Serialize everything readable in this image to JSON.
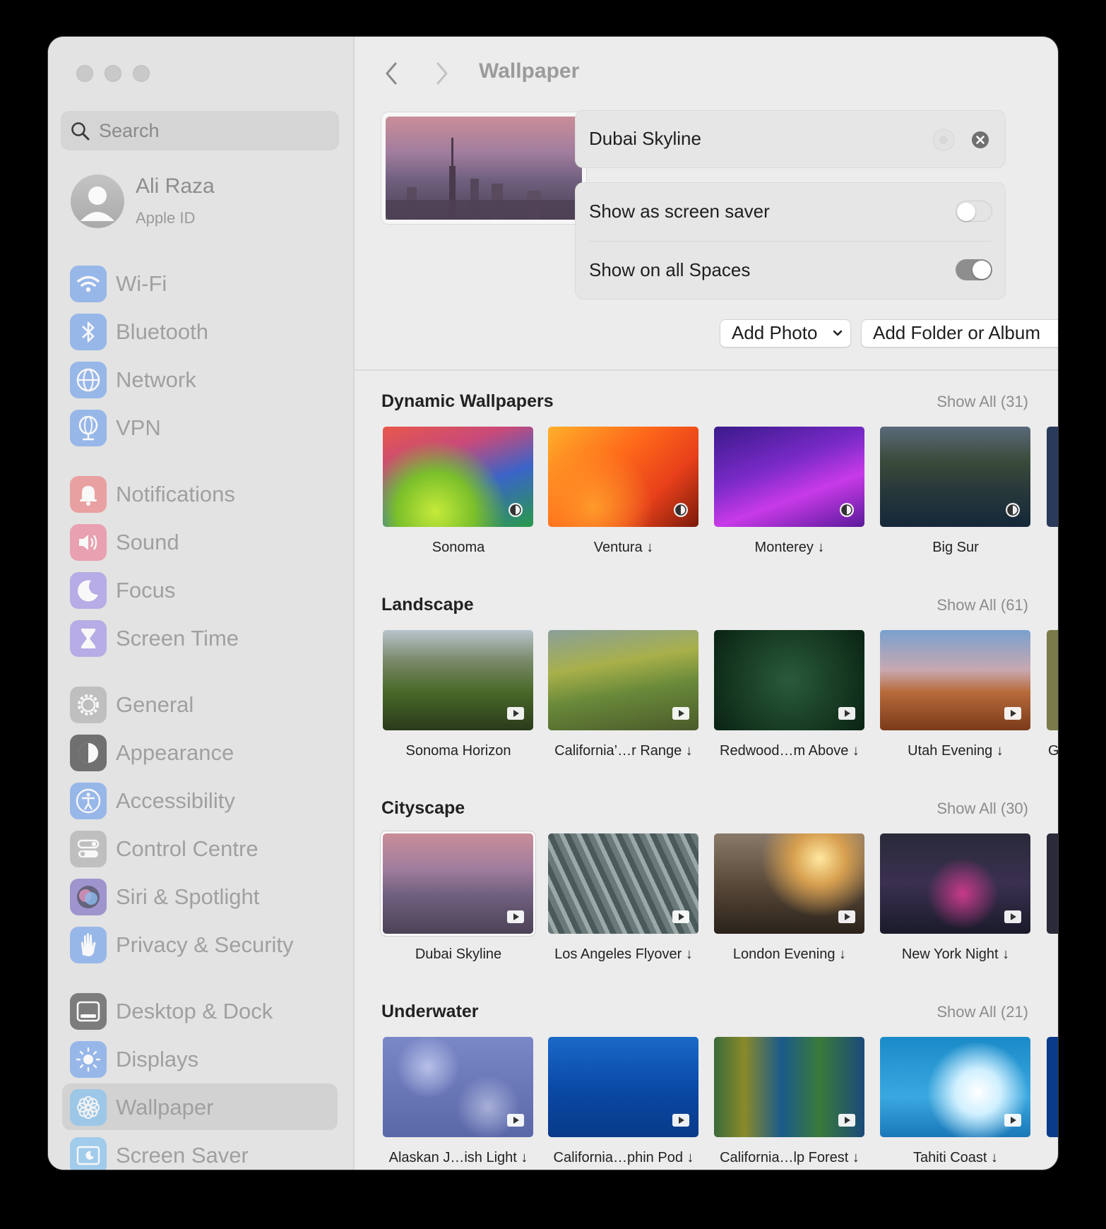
{
  "window": {
    "title": "Wallpaper"
  },
  "sidebar": {
    "search_placeholder": "Search",
    "profile": {
      "name": "Ali Raza",
      "subtitle": "Apple ID"
    },
    "items": [
      {
        "label": "Wi-Fi",
        "icon": "wifi-icon",
        "color": "#7fa9ec"
      },
      {
        "label": "Bluetooth",
        "icon": "bluetooth-icon",
        "color": "#7fa9ec"
      },
      {
        "label": "Network",
        "icon": "globe-icon",
        "color": "#7fa9ec"
      },
      {
        "label": "VPN",
        "icon": "vpn-globe-icon",
        "color": "#7fa9ec"
      },
      {
        "label": "Notifications",
        "icon": "bell-icon",
        "color": "#ec8a8a"
      },
      {
        "label": "Sound",
        "icon": "speaker-icon",
        "color": "#ec8aa0"
      },
      {
        "label": "Focus",
        "icon": "moon-icon",
        "color": "#a99ae6"
      },
      {
        "label": "Screen Time",
        "icon": "hourglass-icon",
        "color": "#a99ae6"
      },
      {
        "label": "General",
        "icon": "gear-icon",
        "color": "#b4b4b4"
      },
      {
        "label": "Appearance",
        "icon": "appearance-icon",
        "color": "#4a4a4a"
      },
      {
        "label": "Accessibility",
        "icon": "accessibility-icon",
        "color": "#7fa9ec"
      },
      {
        "label": "Control Centre",
        "icon": "control-centre-icon",
        "color": "#b4b4b4"
      },
      {
        "label": "Siri & Spotlight",
        "icon": "siri-icon",
        "color": "#8a7ac8"
      },
      {
        "label": "Privacy & Security",
        "icon": "hand-icon",
        "color": "#7fa9ec"
      },
      {
        "label": "Desktop & Dock",
        "icon": "dock-icon",
        "color": "#5a5a5a"
      },
      {
        "label": "Displays",
        "icon": "sun-icon",
        "color": "#7fa9ec"
      },
      {
        "label": "Wallpaper",
        "icon": "flower-icon",
        "color": "#8cc4ee"
      },
      {
        "label": "Screen Saver",
        "icon": "screen-saver-icon",
        "color": "#8cc4ee"
      }
    ]
  },
  "main": {
    "title": "Wallpaper",
    "current_wallpaper": "Dubai Skyline",
    "options": [
      {
        "label": "Show as screen saver",
        "on": false
      },
      {
        "label": "Show on all Spaces",
        "on": true
      }
    ],
    "buttons": {
      "add_photo": "Add Photo",
      "add_folder": "Add Folder or Album"
    },
    "sections": [
      {
        "title": "Dynamic Wallpapers",
        "show_all": "Show All (31)",
        "items": [
          {
            "caption": "Sonoma",
            "badge": "dynamic"
          },
          {
            "caption": "Ventura ↓",
            "badge": "dynamic"
          },
          {
            "caption": "Monterey ↓",
            "badge": "dynamic"
          },
          {
            "caption": "Big Sur",
            "badge": "dynamic"
          }
        ]
      },
      {
        "title": "Landscape",
        "show_all": "Show All (61)",
        "items": [
          {
            "caption": "Sonoma Horizon",
            "badge": "video"
          },
          {
            "caption": "California’…r Range ↓",
            "badge": "video"
          },
          {
            "caption": "Redwood…m Above ↓",
            "badge": "video"
          },
          {
            "caption": "Utah Evening ↓",
            "badge": "video"
          }
        ],
        "overflow_caption": "G"
      },
      {
        "title": "Cityscape",
        "show_all": "Show All (30)",
        "items": [
          {
            "caption": "Dubai Skyline",
            "badge": "video",
            "selected": true
          },
          {
            "caption": "Los Angeles Flyover ↓",
            "badge": "video"
          },
          {
            "caption": "London Evening ↓",
            "badge": "video"
          },
          {
            "caption": "New York Night ↓",
            "badge": "video"
          }
        ]
      },
      {
        "title": "Underwater",
        "show_all": "Show All (21)",
        "items": [
          {
            "caption": "Alaskan J…ish Light ↓",
            "badge": "video"
          },
          {
            "caption": "California…phin Pod ↓",
            "badge": "video"
          },
          {
            "caption": "California…lp Forest ↓",
            "badge": "video"
          },
          {
            "caption": "Tahiti Coast ↓",
            "badge": "video"
          }
        ]
      }
    ]
  }
}
